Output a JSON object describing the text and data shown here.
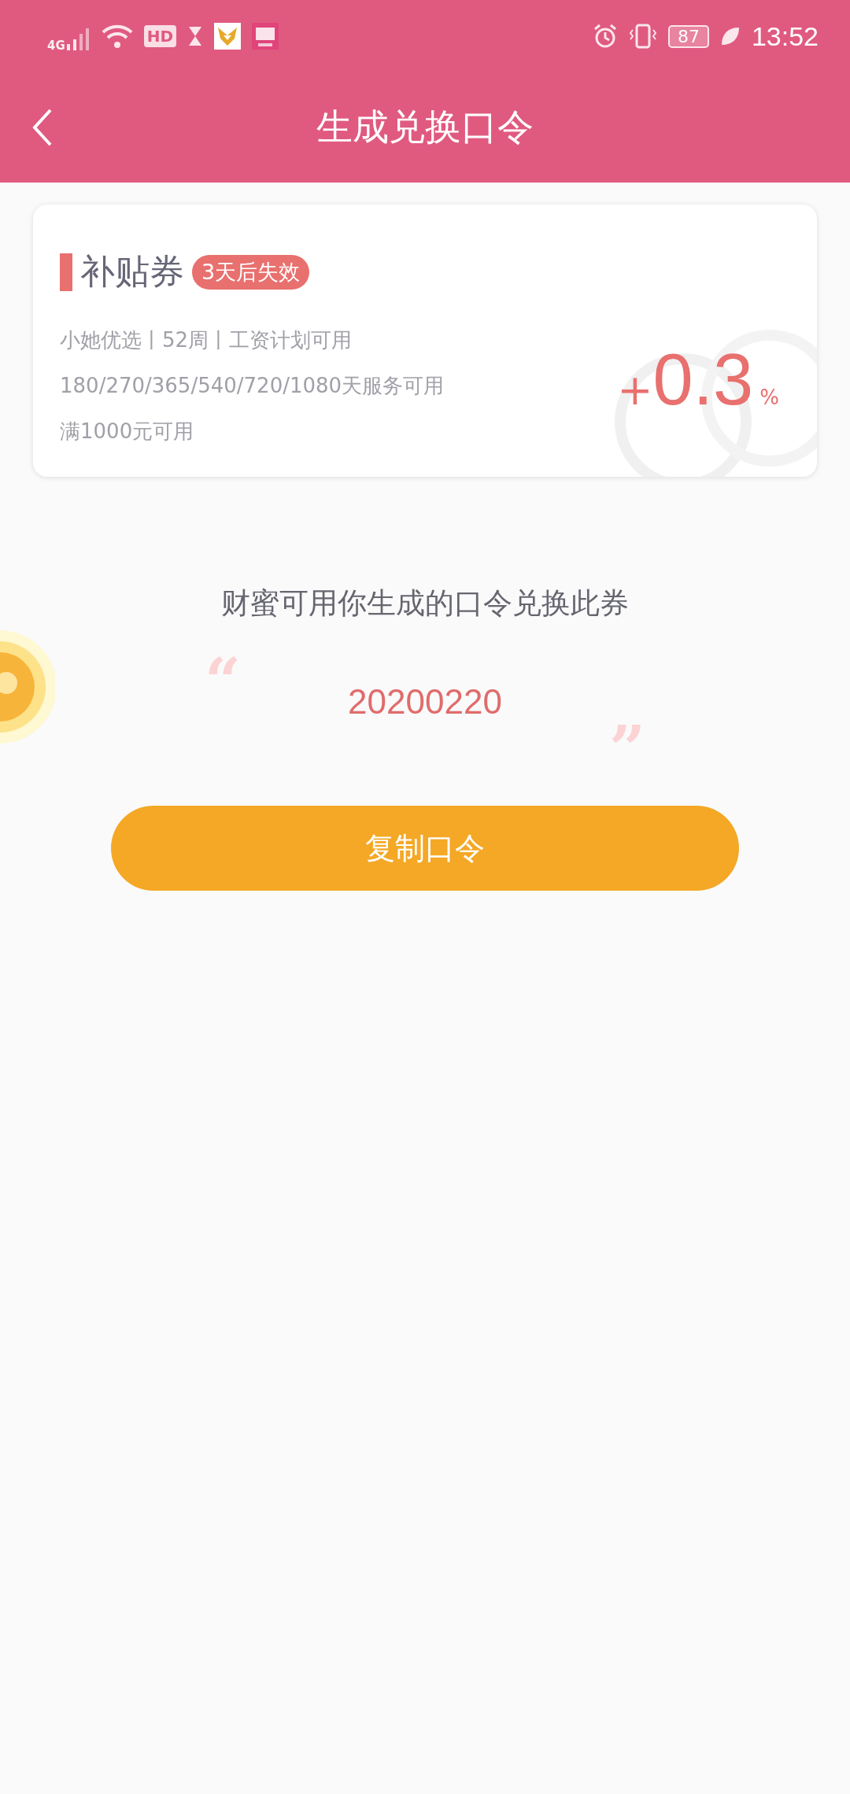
{
  "status_bar": {
    "network": "4G",
    "hd": "HD",
    "battery": "87",
    "time": "13:52"
  },
  "header": {
    "title": "生成兑换口令"
  },
  "coupon": {
    "title": "补贴券",
    "badge": "3天后失效",
    "lines": [
      "小她优选丨52周丨工资计划可用",
      "180/270/365/540/720/1080天服务可用",
      "满1000元可用"
    ],
    "sign": "+",
    "value": "0.3",
    "unit": "%"
  },
  "hint": "财蜜可用你生成的口令兑换此券",
  "open_quote": "“",
  "code": "20200220",
  "close_quote": "”",
  "copy_button": "复制口令"
}
